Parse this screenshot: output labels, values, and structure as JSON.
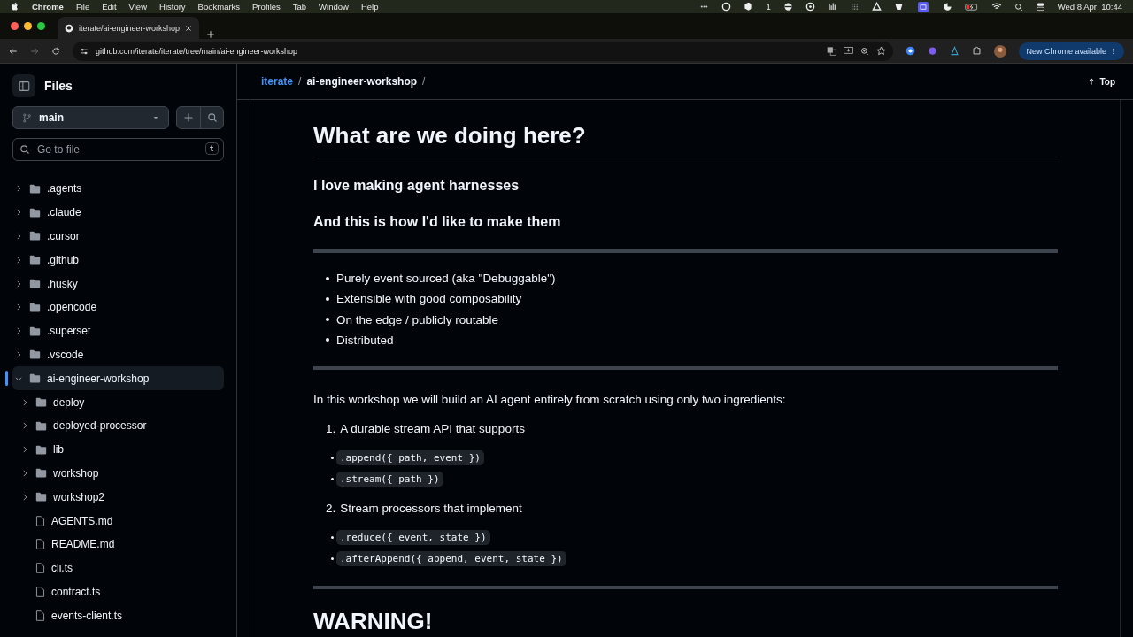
{
  "menu_bar": {
    "app": "Chrome",
    "items": [
      "File",
      "Edit",
      "View",
      "History",
      "Bookmarks",
      "Profiles",
      "Tab",
      "Window",
      "Help"
    ],
    "badge_count": "1",
    "clock": "Wed 8 Apr  10:44"
  },
  "browser": {
    "tab_title": "iterate/ai-engineer-workshop",
    "url": "github.com/iterate/iterate/tree/main/ai-engineer-workshop",
    "update_button": "New Chrome available"
  },
  "sidebar": {
    "title": "Files",
    "branch": "main",
    "search_placeholder": "Go to file",
    "shortcut": "t",
    "tree": [
      {
        "name": ".agents",
        "kind": "folder",
        "expanded": false,
        "selected": false
      },
      {
        "name": ".claude",
        "kind": "folder",
        "expanded": false,
        "selected": false
      },
      {
        "name": ".cursor",
        "kind": "folder",
        "expanded": false,
        "selected": false
      },
      {
        "name": ".github",
        "kind": "folder",
        "expanded": false,
        "selected": false
      },
      {
        "name": ".husky",
        "kind": "folder",
        "expanded": false,
        "selected": false
      },
      {
        "name": ".opencode",
        "kind": "folder",
        "expanded": false,
        "selected": false
      },
      {
        "name": ".superset",
        "kind": "folder",
        "expanded": false,
        "selected": false
      },
      {
        "name": ".vscode",
        "kind": "folder",
        "expanded": false,
        "selected": false
      },
      {
        "name": "ai-engineer-workshop",
        "kind": "folder",
        "expanded": true,
        "selected": true,
        "children": [
          {
            "name": "deploy",
            "kind": "folder",
            "expanded": false,
            "selected": false
          },
          {
            "name": "deployed-processor",
            "kind": "folder",
            "expanded": false,
            "selected": false
          },
          {
            "name": "lib",
            "kind": "folder",
            "expanded": false,
            "selected": false
          },
          {
            "name": "workshop",
            "kind": "folder",
            "expanded": false,
            "selected": false
          },
          {
            "name": "workshop2",
            "kind": "folder",
            "expanded": false,
            "selected": false
          },
          {
            "name": "AGENTS.md",
            "kind": "file",
            "selected": false
          },
          {
            "name": "README.md",
            "kind": "file",
            "selected": false
          },
          {
            "name": "cli.ts",
            "kind": "file",
            "selected": false
          },
          {
            "name": "contract.ts",
            "kind": "file",
            "selected": false
          },
          {
            "name": "events-client.ts",
            "kind": "file",
            "selected": false
          }
        ]
      }
    ]
  },
  "breadcrumb": {
    "parts": [
      {
        "name": "iterate",
        "separator": "/"
      },
      {
        "name": "ai-engineer-workshop",
        "separator": "/"
      }
    ],
    "top_button": "Top"
  },
  "readme": [
    {
      "kind": "h1",
      "text": "What are we doing here?"
    },
    {
      "kind": "h3",
      "text": "I love making agent harnesses"
    },
    {
      "kind": "h3",
      "text": "And this is how I'd like to make them"
    },
    {
      "kind": "hr"
    },
    {
      "kind": "ul",
      "items": [
        "Purely event sourced (aka \"Debuggable\")",
        "Extensible with good composability",
        "On the edge / publicly routable",
        "Distributed"
      ]
    },
    {
      "kind": "hr"
    },
    {
      "kind": "p",
      "text": "In this workshop we will build an AI agent entirely from scratch using only two ingredients:"
    },
    {
      "kind": "ol",
      "number": "1.",
      "text": "A durable stream API that supports"
    },
    {
      "kind": "code_list",
      "items": [
        ".append({ path, event })",
        ".stream({ path })"
      ]
    },
    {
      "kind": "ol",
      "number": "2.",
      "text": "Stream processors that implement"
    },
    {
      "kind": "code_list",
      "items": [
        ".reduce({ event, state })",
        ".afterAppend({ append, event, state })"
      ]
    },
    {
      "kind": "hr"
    },
    {
      "kind": "h1",
      "text": "WARNING!"
    }
  ]
}
